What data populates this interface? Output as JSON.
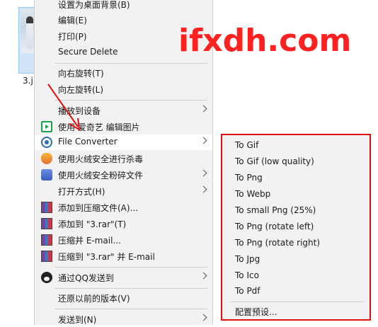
{
  "desktop": {
    "file_label": "3.j"
  },
  "context_menu": {
    "items": [
      {
        "label": "设置为桌面背景(B)"
      },
      {
        "label": "编辑(E)"
      },
      {
        "label": "打印(P)"
      },
      {
        "label": "Secure Delete"
      },
      {
        "label": "向右旋转(T)"
      },
      {
        "label": "向左旋转(L)"
      },
      {
        "label": "播放到设备"
      },
      {
        "label": "使用 爱奇艺 编辑图片"
      },
      {
        "label": "File Converter"
      },
      {
        "label": "使用火绒安全进行杀毒"
      },
      {
        "label": "使用火绒安全粉碎文件"
      },
      {
        "label": "打开方式(H)"
      },
      {
        "label": "添加到压缩文件(A)..."
      },
      {
        "label": "添加到 \"3.rar\"(T)"
      },
      {
        "label": "压缩并 E-mail..."
      },
      {
        "label": "压缩到 \"3.rar\" 并 E-mail"
      },
      {
        "label": "通过QQ发送到"
      },
      {
        "label": "还原以前的版本(V)"
      },
      {
        "label": "发送到(N)"
      }
    ]
  },
  "submenu": {
    "items": [
      {
        "label": "To Gif"
      },
      {
        "label": "To Gif (low quality)"
      },
      {
        "label": "To Png"
      },
      {
        "label": "To Webp"
      },
      {
        "label": "To small Png (25%)"
      },
      {
        "label": "To Png (rotate left)"
      },
      {
        "label": "To Png (rotate right)"
      },
      {
        "label": "To Jpg"
      },
      {
        "label": "To Ico"
      },
      {
        "label": "To Pdf"
      }
    ],
    "settings_label": "配置预设..."
  },
  "watermark": {
    "text": "ifxdh.com"
  },
  "colors": {
    "annotation": "#e01010",
    "menu_bg": "#f2f2f2",
    "hover_bg": "#ffffff"
  },
  "icons": {
    "play_to_device": "tv-play-icon",
    "iqiyi": "iqiyi-icon",
    "file_converter": "file-converter-icon",
    "huorong_scan": "huorong-shield-icon",
    "huorong_shred": "huorong-shred-icon",
    "winrar": "winrar-icon",
    "qq": "qq-icon"
  }
}
